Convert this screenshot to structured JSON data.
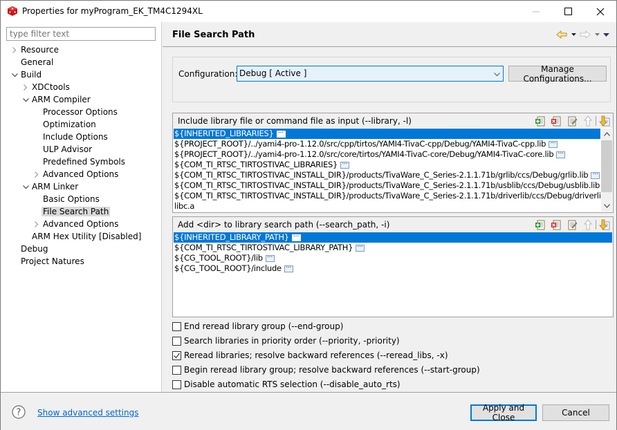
{
  "window": {
    "title": "Properties for myProgram_EK_TM4C1294XL",
    "app_icon": "ccs-cube-icon",
    "controls": [
      "minimize",
      "maximize",
      "close"
    ]
  },
  "sidebar": {
    "filter_placeholder": "type filter text",
    "items": [
      {
        "label": "Resource",
        "level": 0,
        "expander": "collapsed"
      },
      {
        "label": "General",
        "level": 0,
        "expander": "none"
      },
      {
        "label": "Build",
        "level": 0,
        "expander": "expanded"
      },
      {
        "label": "XDCtools",
        "level": 1,
        "expander": "collapsed"
      },
      {
        "label": "ARM Compiler",
        "level": 1,
        "expander": "expanded"
      },
      {
        "label": "Processor Options",
        "level": 2,
        "expander": "none"
      },
      {
        "label": "Optimization",
        "level": 2,
        "expander": "none"
      },
      {
        "label": "Include Options",
        "level": 2,
        "expander": "none"
      },
      {
        "label": "ULP Advisor",
        "level": 2,
        "expander": "none"
      },
      {
        "label": "Predefined Symbols",
        "level": 2,
        "expander": "none"
      },
      {
        "label": "Advanced Options",
        "level": 2,
        "expander": "collapsed"
      },
      {
        "label": "ARM Linker",
        "level": 1,
        "expander": "expanded"
      },
      {
        "label": "Basic Options",
        "level": 2,
        "expander": "none"
      },
      {
        "label": "File Search Path",
        "level": 2,
        "expander": "none",
        "selected": true
      },
      {
        "label": "Advanced Options",
        "level": 2,
        "expander": "collapsed"
      },
      {
        "label": "ARM Hex Utility  [Disabled]",
        "level": 1,
        "expander": "none"
      },
      {
        "label": "Debug",
        "level": 0,
        "expander": "none"
      },
      {
        "label": "Project Natures",
        "level": 0,
        "expander": "none"
      }
    ]
  },
  "page": {
    "title": "File Search Path",
    "nav": {
      "back": "back-arrow-icon",
      "forward": "forward-arrow-icon",
      "menu": "view-menu-icon"
    },
    "configuration": {
      "label": "Configuration:",
      "value": "Debug  [ Active ]",
      "manage_label": "Manage Configurations..."
    },
    "library_panel": {
      "title": "Include library file or command file as input (--library, -l)",
      "tools": [
        "add-icon",
        "delete-icon",
        "edit-icon",
        "move-up-icon",
        "move-down-icon"
      ],
      "rows": [
        {
          "text": "${INHERITED_LIBRARIES}",
          "more": true,
          "selected": true
        },
        {
          "text": "${PROJECT_ROOT}/../yami4-pro-1.12.0/src/cpp/tirtos/YAMI4-TivaC-cpp/Debug/YAMI4-TivaC-cpp.lib",
          "more": true
        },
        {
          "text": "${PROJECT_ROOT}/../yami4-pro-1.12.0/src/core/tirtos/YAMI4-TivaC-core/Debug/YAMI4-TivaC-core.lib",
          "more": true
        },
        {
          "text": "${COM_TI_RTSC_TIRTOSTIVAC_LIBRARIES}",
          "more": true
        },
        {
          "text": "${COM_TI_RTSC_TIRTOSTIVAC_INSTALL_DIR}/products/TivaWare_C_Series-2.1.1.71b/grlib/ccs/Debug/grlib.lib",
          "more": true
        },
        {
          "text": "${COM_TI_RTSC_TIRTOSTIVAC_INSTALL_DIR}/products/TivaWare_C_Series-2.1.1.71b/usblib/ccs/Debug/usblib.lib",
          "more": true
        },
        {
          "text": "${COM_TI_RTSC_TIRTOSTIVAC_INSTALL_DIR}/products/TivaWare_C_Series-2.1.1.71b/driverlib/ccs/Debug/driverlib.lib",
          "more": false
        },
        {
          "text": "libc.a",
          "more": false
        }
      ]
    },
    "path_panel": {
      "title": "Add <dir> to library search path (--search_path, -i)",
      "tools": [
        "add-icon",
        "delete-icon",
        "edit-icon",
        "move-up-icon",
        "move-down-icon"
      ],
      "rows": [
        {
          "text": "${INHERITED_LIBRARY_PATH}",
          "more": true,
          "selected": true
        },
        {
          "text": "${COM_TI_RTSC_TIRTOSTIVAC_LIBRARY_PATH}",
          "more": true
        },
        {
          "text": "${CG_TOOL_ROOT}/lib",
          "more": true
        },
        {
          "text": "${CG_TOOL_ROOT}/include",
          "more": true
        }
      ]
    },
    "checkboxes": [
      {
        "label": "End reread library group (--end-group)",
        "checked": false
      },
      {
        "label": "Search libraries in priority order (--priority, -priority)",
        "checked": false
      },
      {
        "label": "Reread libraries; resolve backward references (--reread_libs, -x)",
        "checked": true
      },
      {
        "label": "Begin reread library group; resolve backward references (--start-group)",
        "checked": false
      },
      {
        "label": "Disable automatic RTS selection (--disable_auto_rts)",
        "checked": false
      }
    ]
  },
  "footer": {
    "help_icon": "help-icon",
    "advanced_link": "Show advanced settings",
    "apply_close": "Apply and Close",
    "cancel": "Cancel"
  }
}
